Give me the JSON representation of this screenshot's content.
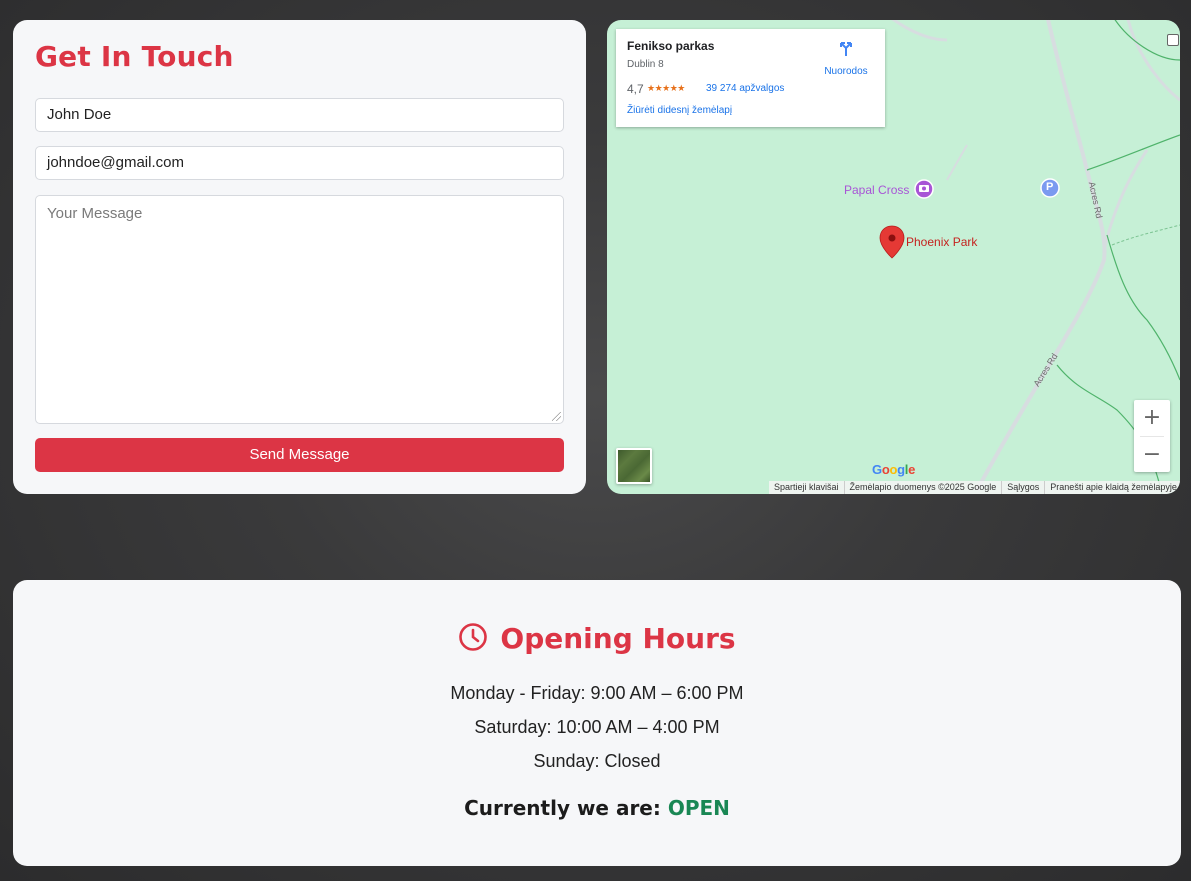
{
  "contact": {
    "title": "Get In Touch",
    "name_value": "John Doe",
    "email_value": "johndoe@gmail.com",
    "message_placeholder": "Your Message",
    "send_label": "Send Message"
  },
  "map": {
    "place_name": "Fenikso parkas",
    "place_address": "Dublin 8",
    "rating": "4,7",
    "stars": "★★★★★",
    "reviews": "39 274 apžvalgos",
    "view_larger": "Žiūrėti didesnį žemėlapį",
    "directions_label": "Nuorodos",
    "poi_papal_cross": "Papal Cross",
    "poi_phoenix_park": "Phoenix Park",
    "parking_label": "P",
    "road_label_1": "Acres Rd",
    "road_label_2": "Acres Rd",
    "zoom_in": "+",
    "zoom_out": "−",
    "google_logo": "Google",
    "attribution": [
      "Spartieji klavišai",
      "Žemėlapio duomenys ©2025 Google",
      "Sąlygos",
      "Pranešti apie klaidą žemėlapyje"
    ]
  },
  "hours": {
    "title": "Opening Hours",
    "weekdays": "Monday - Friday: 9:00 AM – 6:00 PM",
    "saturday": "Saturday: 10:00 AM – 4:00 PM",
    "sunday": "Sunday: Closed",
    "status_prefix": "Currently we are:",
    "status_value": "OPEN"
  },
  "colors": {
    "accent": "#dc3545",
    "open_status": "#198754",
    "map_green": "#c6f0d6"
  }
}
